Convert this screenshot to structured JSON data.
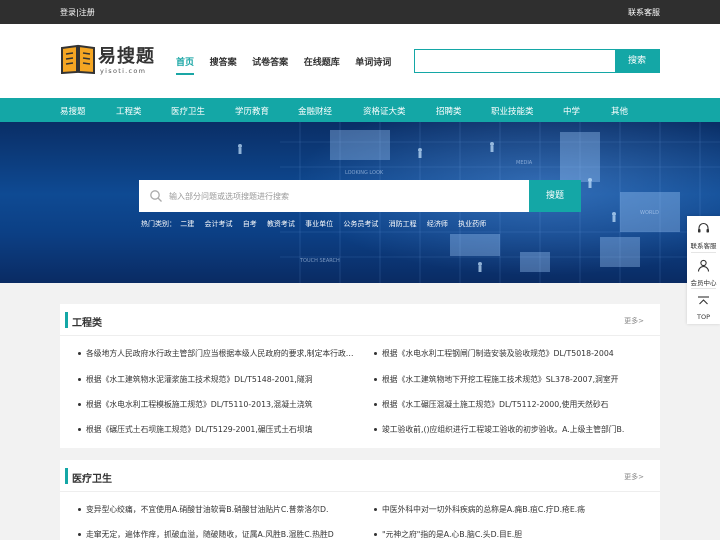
{
  "topbar": {
    "login": "登录|注册",
    "contact": "联系客服"
  },
  "logo": {
    "brand": "易搜题",
    "domain": "yisoti.com"
  },
  "nav": [
    {
      "label": "首页",
      "active": true
    },
    {
      "label": "搜答案",
      "active": false
    },
    {
      "label": "试卷答案",
      "active": false
    },
    {
      "label": "在线题库",
      "active": false
    },
    {
      "label": "单词诗词",
      "active": false
    }
  ],
  "header_search": {
    "value": "",
    "button": "搜索"
  },
  "categories": [
    "易搜题",
    "工程类",
    "医疗卫生",
    "学历教育",
    "金融财经",
    "资格证大类",
    "招聘类",
    "职业技能类",
    "中学",
    "其他"
  ],
  "banner": {
    "search_placeholder": "输入部分问题或选项搜题进行搜索",
    "search_button": "搜题",
    "hot_label": "热门类别：",
    "hot_items": [
      "二建",
      "会计考试",
      "自考",
      "教资考试",
      "事业单位",
      "公务员考试",
      "消防工程",
      "经济师",
      "执业药师"
    ],
    "deco_text": [
      "LOOKING LOOK",
      "MEDIA",
      "WORLD",
      "TOUCH SEARCH"
    ]
  },
  "side_float": [
    {
      "icon": "headset-icon",
      "label": "联系客服"
    },
    {
      "icon": "user-icon",
      "label": "会员中心"
    },
    {
      "icon": "top-arrow-icon",
      "label": "TOP"
    }
  ],
  "sections": [
    {
      "title": "工程类",
      "more": "更多>",
      "items": [
        "各级地方人民政府水行政主管部门应当根据本级人民政府的要求,制定本行政区域内的水利工程",
        "根据《水电水利工程钢闸门制造安装及验收规范》DL/T5018-2004",
        "根据《水工建筑物水泥灌浆施工技术规范》DL/T5148-2001,隧洞",
        "根据《水工建筑物地下开挖工程施工技术规范》SL378-2007,洞室开",
        "根据《水电水利工程模板施工规范》DL/T5110-2013,混凝土浇筑",
        "根据《水工碾压混凝土施工规范》DL/T5112-2000,使用天然砂石",
        "根据《碾压式土石坝施工规范》DL/T5129-2001,碾压式土石坝填",
        "竣工验收前,()应组织进行工程竣工验收的初步验收。A.上级主管部门B."
      ]
    },
    {
      "title": "医疗卫生",
      "more": "更多>",
      "items": [
        "变异型心绞痛，不宜使用A.硝酸甘油软膏B.硝酸甘油贴片C.普萘洛尔D.",
        "中医外科中对一切外科疾病的总称是A.痈B.疽C.疔D.疮E.疡",
        "走窜无定，遍体作痒，抓破血溢，随破随收，证属A.风胜B.湿胜C.热胜D",
        "\"元神之府\"指的是A.心B.脑C.头D.目E.胆"
      ]
    }
  ]
}
